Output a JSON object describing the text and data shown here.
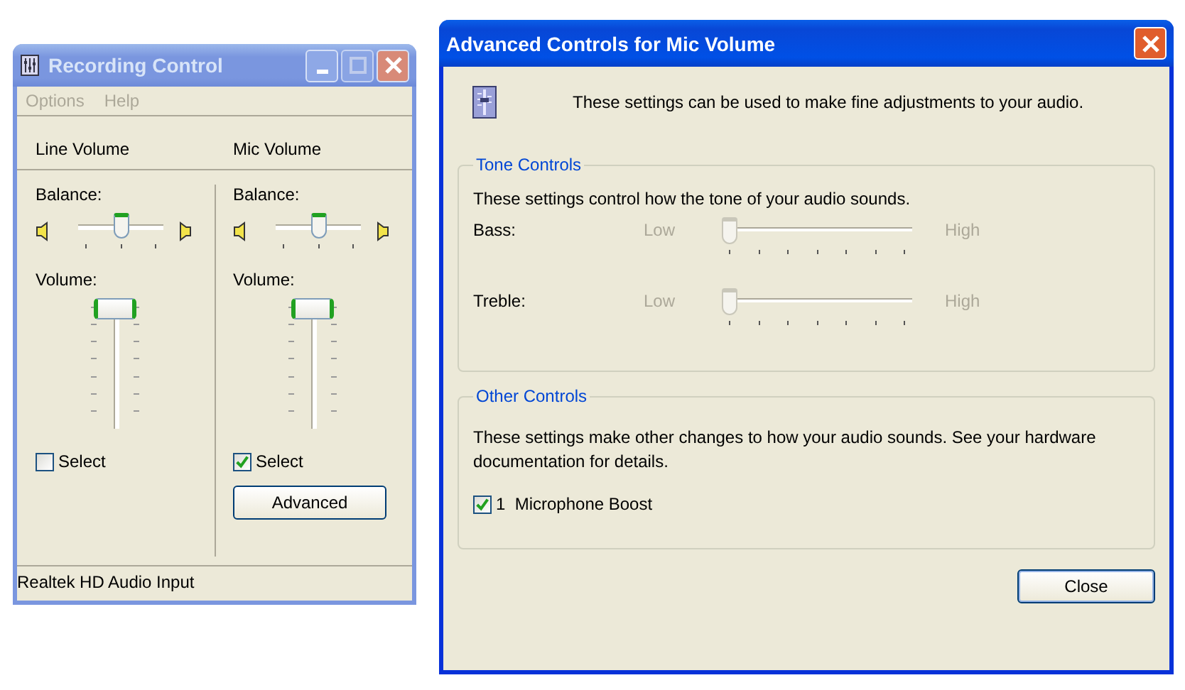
{
  "recording_window": {
    "title": "Recording Control",
    "active": false,
    "menu": [
      {
        "label": "Options",
        "disabled": true
      },
      {
        "label": "Help",
        "disabled": true
      }
    ],
    "channels": [
      {
        "name": "Line Volume",
        "balance": {
          "label": "Balance:",
          "level": 0.5
        },
        "volume": {
          "label": "Volume:",
          "level": 1
        },
        "select": {
          "label": "Select",
          "checked": false
        }
      },
      {
        "name": "Mic Volume",
        "balance": {
          "label": "Balance:",
          "level": 0.5
        },
        "volume": {
          "label": "Volume:",
          "level": 1
        },
        "select": {
          "label": "Select",
          "checked": true
        },
        "button": "Advanced"
      }
    ],
    "status_bar": "Realtek HD Audio Input"
  },
  "advanced_window": {
    "title": "Advanced Controls for Mic Volume",
    "active": true,
    "intro": "These settings can be used to make fine adjustments to your audio.",
    "tone_controls": {
      "legend": "Tone Controls",
      "description": "These settings control how the tone of your audio sounds.",
      "sliders": [
        {
          "label": "Bass:",
          "low": "Low",
          "high": "High",
          "level": 0,
          "disabled": true
        },
        {
          "label": "Treble:",
          "low": "Low",
          "high": "High",
          "level": 0,
          "disabled": true
        }
      ]
    },
    "other_controls": {
      "legend": "Other Controls",
      "description": "These settings make other changes to how your audio sounds.  See your hardware documentation for details.",
      "options": [
        {
          "label": "1  Microphone Boost",
          "checked": true
        }
      ]
    },
    "buttons": [
      "Close"
    ]
  }
}
